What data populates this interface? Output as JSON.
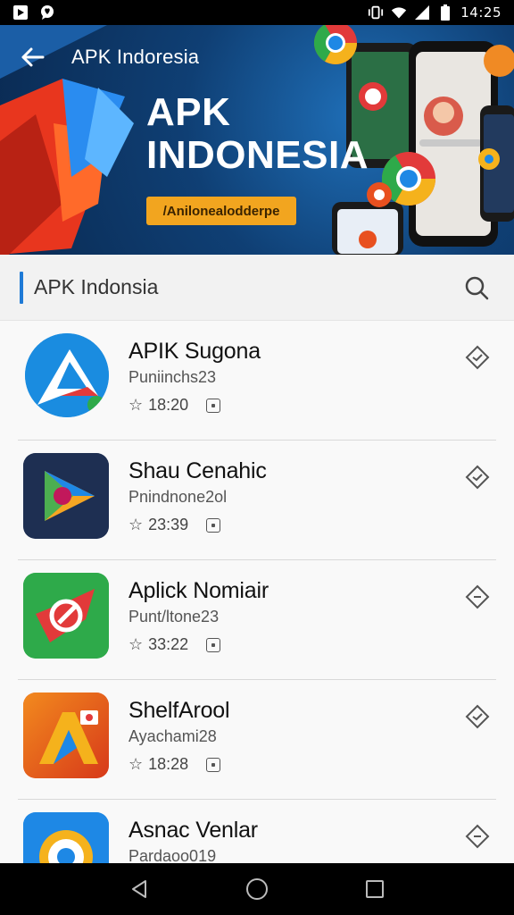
{
  "status_bar": {
    "time": "14:25",
    "icons": [
      "media-icon",
      "chat-bubble-icon",
      "vibrate-icon",
      "wifi-icon",
      "cell-signal-icon",
      "battery-icon"
    ]
  },
  "header": {
    "title": "APK Indoresia",
    "back_icon": "arrow-left-icon"
  },
  "hero": {
    "headline_line1": "APK",
    "headline_line2": "INDONESIA",
    "chip": "/Anilonealodderpe"
  },
  "section": {
    "title": "APK Indonsia",
    "search_icon": "search-icon"
  },
  "apps": [
    {
      "name": "APIK Sugona",
      "developer": "Puniinchs23",
      "rating": "18:20",
      "icon_colors": [
        "#1a8ce0",
        "#ffffff",
        "#e23a3a"
      ]
    },
    {
      "name": "Shau Cenahic",
      "developer": "Pnindnone2ol",
      "rating": "23:39",
      "icon_colors": [
        "#1e2f52",
        "#4caf50",
        "#ff9800"
      ]
    },
    {
      "name": "Aplick Nomiair",
      "developer": "Punt/ltone23",
      "rating": "33:22",
      "icon_colors": [
        "#2eaa4a",
        "#e23a3a",
        "#ffffff"
      ]
    },
    {
      "name": "ShelfArool",
      "developer": "Ayachami28",
      "rating": "18:28",
      "icon_colors": [
        "#e8501f",
        "#f5b21c",
        "#1e88e5"
      ]
    },
    {
      "name": "Asnac Venlar",
      "developer": "Pardaoo019",
      "rating": "",
      "icon_colors": [
        "#1e88e5",
        "#f5b21c",
        "#ffffff"
      ]
    }
  ],
  "nav": {
    "back": "triangle-back-icon",
    "home": "circle-home-icon",
    "recents": "square-recents-icon"
  }
}
